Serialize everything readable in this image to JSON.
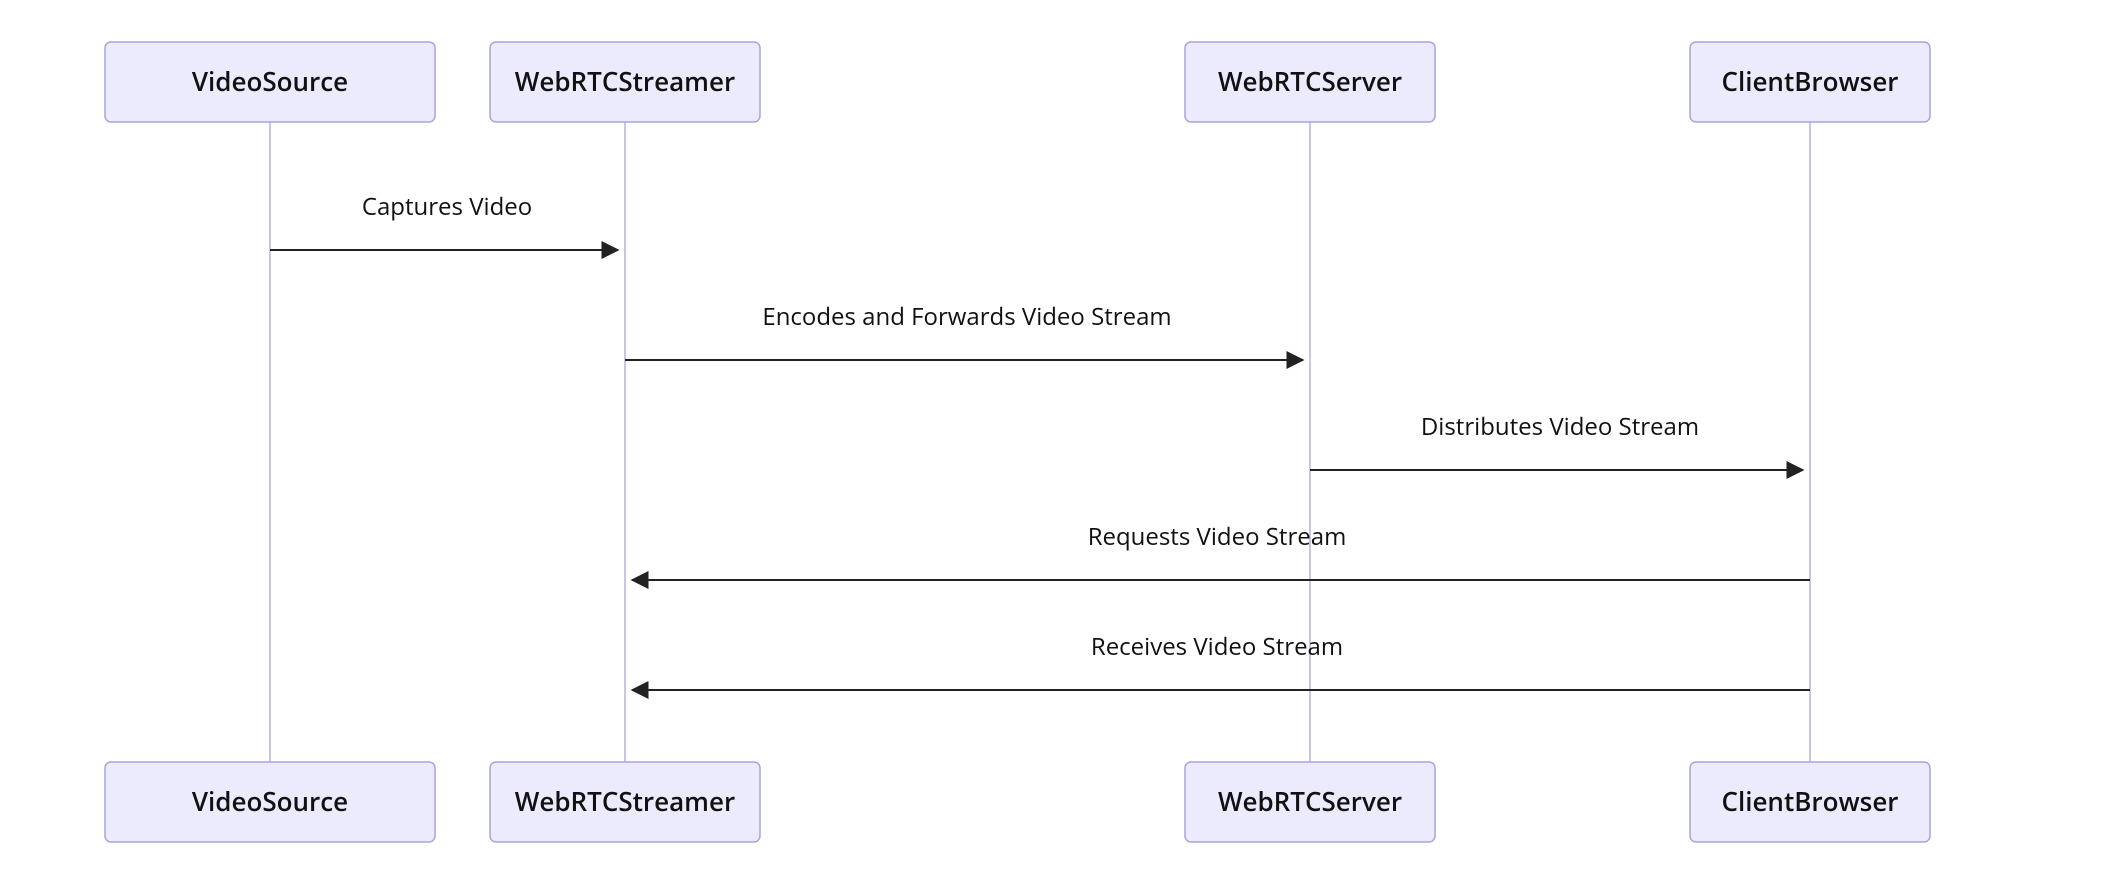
{
  "chart_data": {
    "type": "sequence-diagram",
    "actors": [
      {
        "id": "video-source",
        "name": "VideoSource"
      },
      {
        "id": "webrtc-streamer",
        "name": "WebRTCStreamer"
      },
      {
        "id": "webrtc-server",
        "name": "WebRTCServer"
      },
      {
        "id": "client-browser",
        "name": "ClientBrowser"
      }
    ],
    "messages": [
      {
        "from": "video-source",
        "to": "webrtc-streamer",
        "label": "Captures Video"
      },
      {
        "from": "webrtc-streamer",
        "to": "webrtc-server",
        "label": "Encodes and Forwards Video Stream"
      },
      {
        "from": "webrtc-server",
        "to": "client-browser",
        "label": "Distributes Video Stream"
      },
      {
        "from": "client-browser",
        "to": "webrtc-streamer",
        "label": "Requests Video Stream"
      },
      {
        "from": "client-browser",
        "to": "webrtc-streamer",
        "label": "Receives Video Stream"
      }
    ]
  },
  "colors": {
    "box_fill": "#eceafd",
    "box_stroke": "#a8a3df",
    "lifeline": "#c8c4ea",
    "arrow": "#222222"
  }
}
